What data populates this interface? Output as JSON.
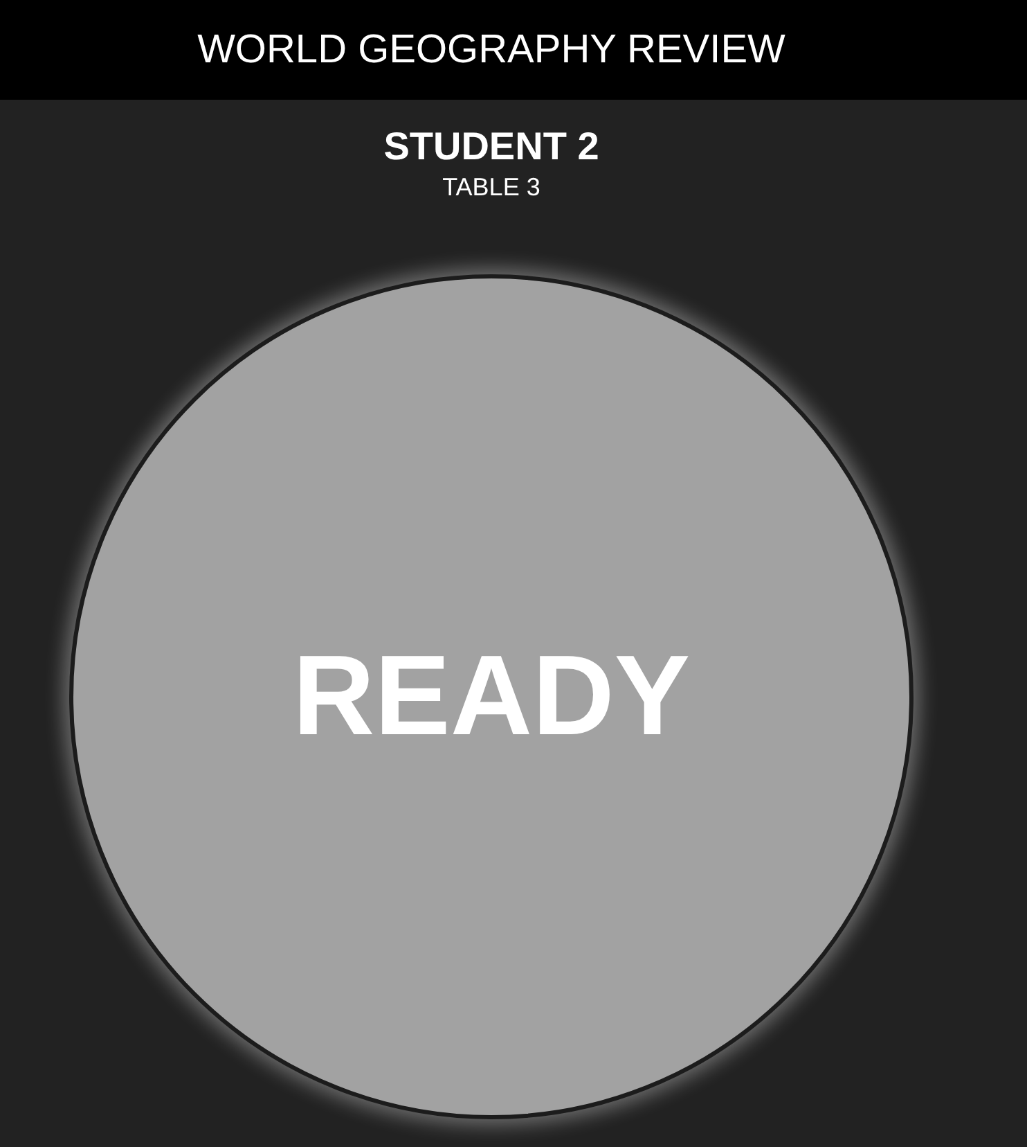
{
  "header": {
    "title": "WORLD GEOGRAPHY REVIEW"
  },
  "student": {
    "name": "STUDENT 2",
    "table": "TABLE 3"
  },
  "buzzer": {
    "label": "READY"
  }
}
